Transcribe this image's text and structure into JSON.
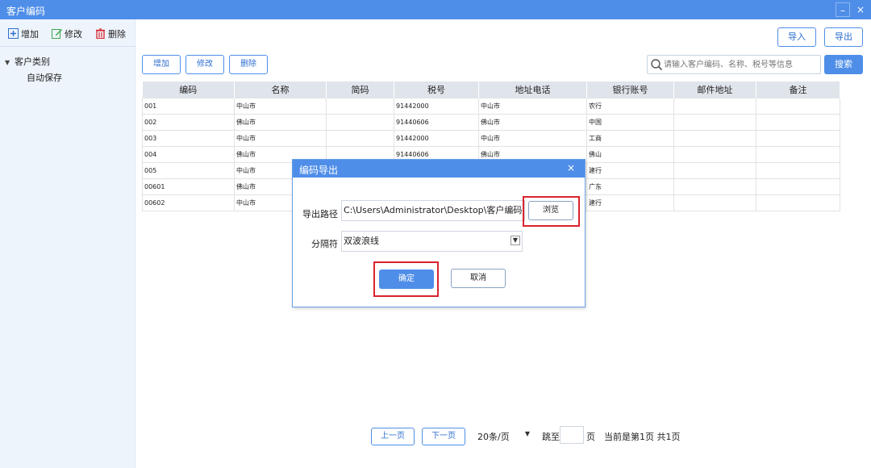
{
  "window": {
    "title": "客户编码",
    "minimize": "–",
    "close": "×"
  },
  "toolbar": {
    "add": "增加",
    "edit": "修改",
    "delete": "删除"
  },
  "tree": {
    "root": "客户类别",
    "child": "自动保存"
  },
  "top_actions": {
    "import": "导入",
    "export": "导出"
  },
  "actions": {
    "add": "增加",
    "edit": "修改",
    "delete": "删除"
  },
  "search": {
    "placeholder": "请输入客户编码、名称、税号等信息",
    "button": "搜索"
  },
  "table": {
    "columns": [
      "编码",
      "名称",
      "简码",
      "税号",
      "地址电话",
      "银行账号",
      "邮件地址",
      "备注"
    ],
    "rows": [
      [
        "001",
        "中山市",
        "",
        "91442000",
        "中山市",
        "农行",
        "",
        ""
      ],
      [
        "002",
        "佛山市",
        "",
        "91440606",
        "佛山市",
        "中国",
        "",
        ""
      ],
      [
        "003",
        "中山市",
        "",
        "91442000",
        "中山市",
        "工商",
        "",
        ""
      ],
      [
        "004",
        "佛山市",
        "",
        "91440606",
        "佛山市",
        "佛山",
        "",
        ""
      ],
      [
        "005",
        "中山市",
        "",
        "",
        "",
        "建行",
        "",
        ""
      ],
      [
        "00601",
        "佛山市",
        "",
        "",
        "",
        "广东",
        "",
        ""
      ],
      [
        "00602",
        "中山市",
        "",
        "",
        "",
        "建行",
        "",
        ""
      ]
    ]
  },
  "dialog": {
    "title": "编码导出",
    "close": "×",
    "path_label": "导出路径",
    "path_value": "C:\\Users\\Administrator\\Desktop\\客户编码.txt",
    "browse": "浏览",
    "separator_label": "分隔符",
    "separator_value": "双波浪线",
    "ok": "确定",
    "cancel": "取消"
  },
  "pager": {
    "prev": "上一页",
    "next": "下一页",
    "page_size": "20条/页",
    "jump": "跳至",
    "page_unit": "页",
    "info": "当前是第1页 共1页"
  },
  "colors": {
    "primary": "#4f8ee8",
    "highlight": "#d9232e",
    "sidebar": "#eef4fc"
  }
}
